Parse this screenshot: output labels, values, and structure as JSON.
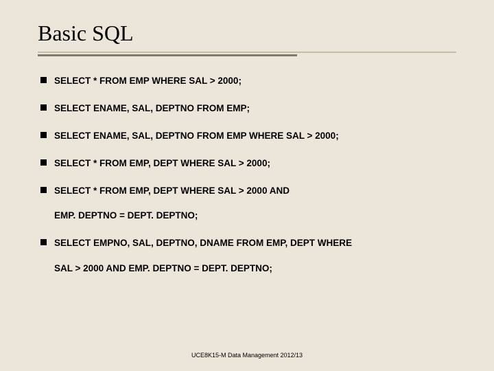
{
  "title": "Basic SQL",
  "bullets": {
    "b1": "SELECT * FROM EMP WHERE SAL > 2000;",
    "b2": "SELECT ENAME, SAL, DEPTNO FROM EMP;",
    "b3": "SELECT ENAME, SAL, DEPTNO FROM EMP WHERE SAL > 2000;",
    "b4": "SELECT * FROM EMP, DEPT WHERE SAL > 2000;",
    "b5_line1": "SELECT * FROM EMP, DEPT WHERE SAL > 2000 AND",
    "b5_line2": "EMP. DEPTNO = DEPT. DEPTNO;",
    "b6_line1": "SELECT EMPNO, SAL, DEPTNO, DNAME FROM EMP, DEPT WHERE",
    "b6_line2": "SAL > 2000 AND EMP. DEPTNO = DEPT. DEPTNO;"
  },
  "footer": "UCE8K15-M Data Management 2012/13"
}
